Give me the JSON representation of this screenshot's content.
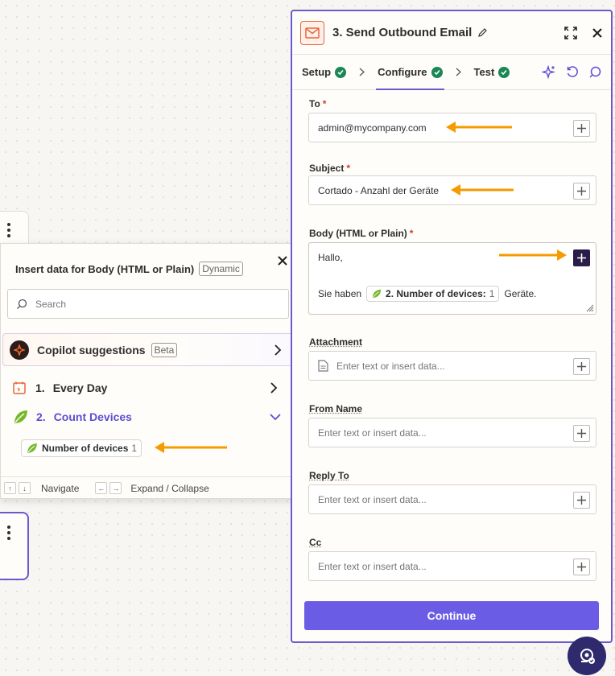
{
  "panel": {
    "title": "3. Send Outbound Email",
    "tabs": [
      {
        "label": "Setup",
        "done": true
      },
      {
        "label": "Configure",
        "done": true,
        "active": true
      },
      {
        "label": "Test",
        "done": true
      }
    ],
    "fields": {
      "to": {
        "label": "To",
        "value": "admin@mycompany.com",
        "required": true
      },
      "subject": {
        "label": "Subject",
        "value": "Cortado - Anzahl der Geräte",
        "required": true
      },
      "body": {
        "label": "Body (HTML or Plain)",
        "required": true,
        "line1": "Hallo,",
        "line2_prefix": "Sie haben",
        "chip_label": "2. Number of devices:",
        "chip_count": "1",
        "line2_suffix": "Geräte."
      },
      "attachment": {
        "label": "Attachment",
        "placeholder": "Enter text or insert data..."
      },
      "from_name": {
        "label": "From Name",
        "placeholder": "Enter text or insert data..."
      },
      "reply_to": {
        "label": "Reply To",
        "placeholder": "Enter text or insert data..."
      },
      "cc": {
        "label": "Cc",
        "placeholder": "Enter text or insert data..."
      }
    },
    "continue_label": "Continue"
  },
  "popup": {
    "title": "Insert data for Body (HTML or Plain)",
    "dynamic_tag": "Dynamic",
    "search_placeholder": "Search",
    "copilot_label": "Copilot suggestions",
    "beta_tag": "Beta",
    "steps": [
      {
        "num": "1.",
        "label": "Every Day"
      },
      {
        "num": "2.",
        "label": "Count Devices"
      }
    ],
    "data_item": {
      "label": "Number of devices",
      "count": "1"
    },
    "footer": {
      "navigate": "Navigate",
      "expand": "Expand / Collapse"
    }
  },
  "colors": {
    "accent": "#6b5ce6",
    "arrow": "#f59b00",
    "success": "#1a8754",
    "brand": "#e8653a"
  }
}
